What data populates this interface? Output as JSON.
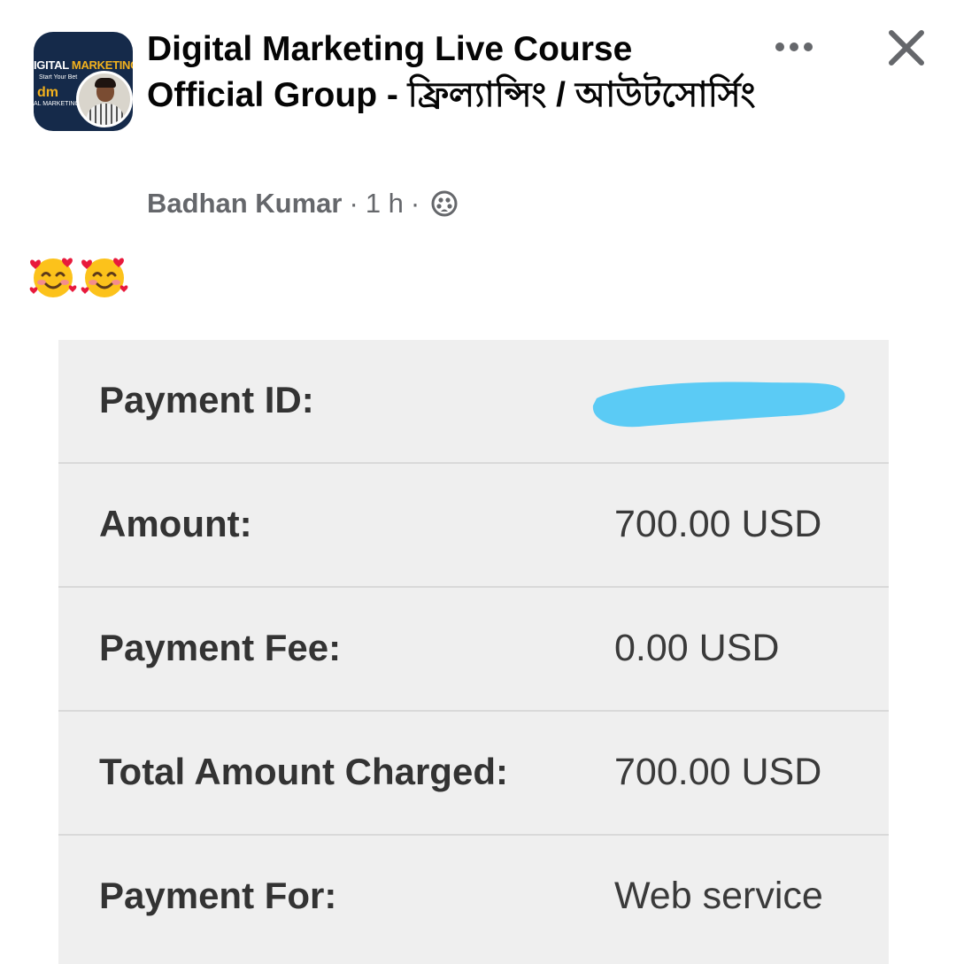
{
  "header": {
    "group_avatar": {
      "line1_a": "IGITAL ",
      "line1_b": "MARKETING",
      "line2": "Start Your Bet",
      "logo": "dm",
      "line3": "AL MARKETING"
    },
    "group_title": "Digital Marketing Live Course Official Group - ফ্রিল্যান্সিং / আউটসোর্সিং",
    "author": "Badhan Kumar",
    "separator": "·",
    "time": "1 h",
    "audience_icon": "members-icon",
    "more_icon": "more-horizontal-icon",
    "close_icon": "close-icon"
  },
  "post": {
    "emojis": [
      "smiling-face-with-hearts-icon",
      "smiling-face-with-hearts-icon"
    ]
  },
  "receipt": {
    "rows": [
      {
        "label": "Payment ID:",
        "value": "",
        "redacted": true
      },
      {
        "label": "Amount:",
        "value": "700.00 USD"
      },
      {
        "label": "Payment Fee:",
        "value": "0.00 USD"
      },
      {
        "label": "Total Amount Charged:",
        "value": "700.00 USD"
      },
      {
        "label": "Payment For:",
        "value": "Web service"
      }
    ],
    "redaction_color": "#5bcbf5"
  },
  "colors": {
    "title": "#050505",
    "meta": "#65676b",
    "receipt_bg": "#efefef",
    "divider": "#d9d9d9"
  }
}
